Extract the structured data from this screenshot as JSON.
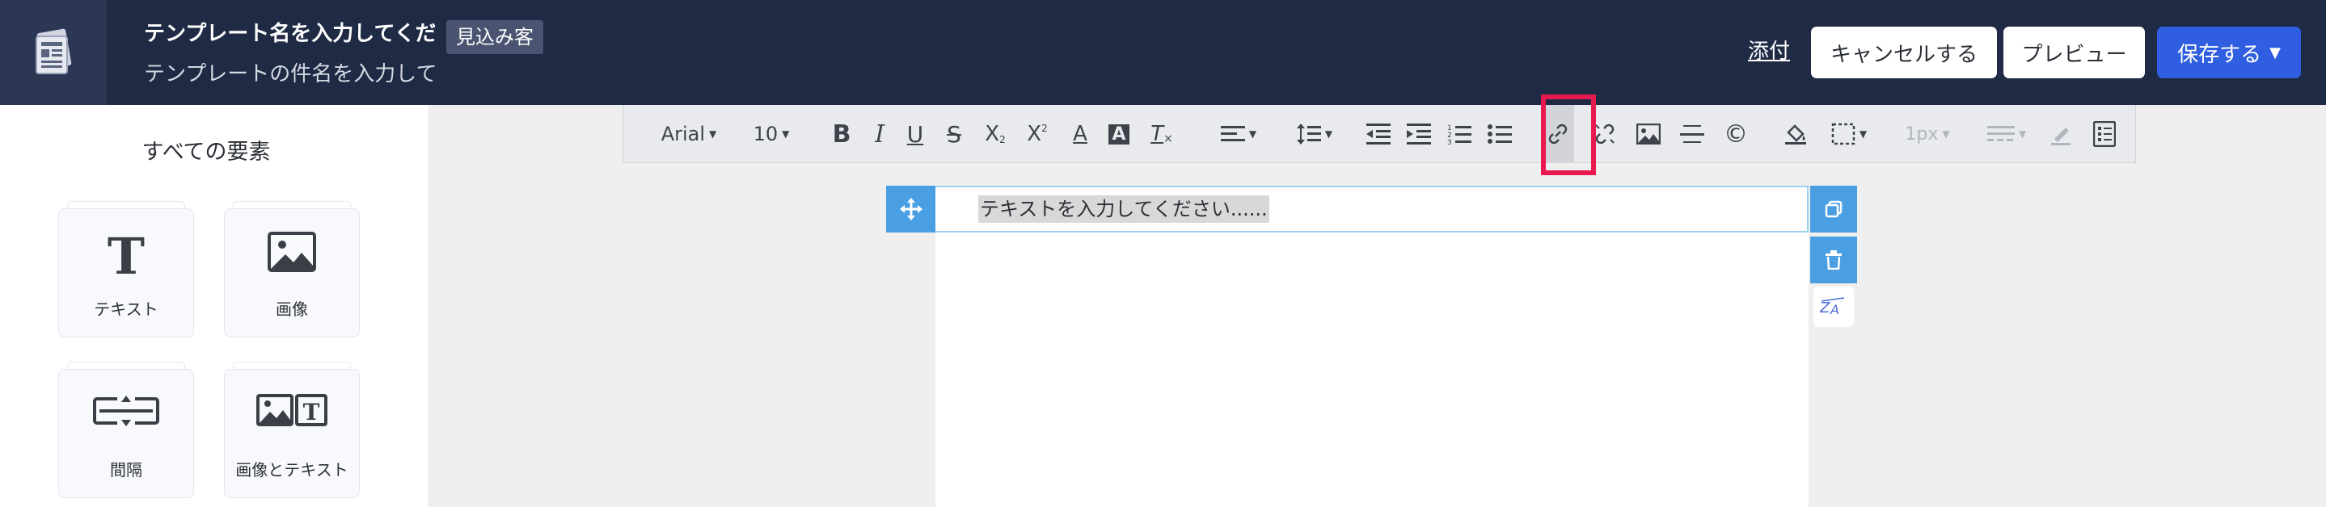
{
  "header": {
    "template_name": "テンプレート名を入力してください",
    "badge": "見込み客",
    "template_subject": "テンプレートの件名を入力してください",
    "attach": "添付",
    "cancel": "キャンセルする",
    "preview": "プレビュー",
    "save": "保存する"
  },
  "left_panel": {
    "title": "すべての要素",
    "elements": [
      {
        "label": "テキスト",
        "icon": "text-icon"
      },
      {
        "label": "画像",
        "icon": "image-icon"
      },
      {
        "label": "間隔",
        "icon": "spacer-icon"
      },
      {
        "label": "画像とテキスト",
        "icon": "image-text-icon"
      }
    ]
  },
  "toolbar": {
    "font": "Arial",
    "size": "10",
    "border_width": "1px"
  },
  "editor": {
    "text_placeholder": "テキストを入力してください......"
  },
  "colors": {
    "header_bg": "#1f2a44",
    "save_button": "#2f5fe0",
    "handle_blue": "#4a9fe3",
    "highlight": "#e8194f"
  }
}
